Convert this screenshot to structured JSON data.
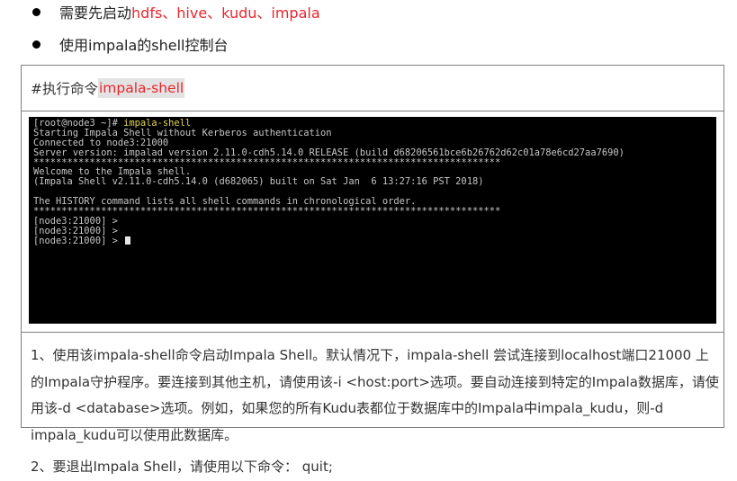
{
  "bullets": [
    {
      "prefix": "需要先启动",
      "suffix": "hdfs、hive、kudu、impala"
    },
    {
      "text": "使用impala的shell控制台"
    }
  ],
  "command_row": {
    "prefix": "#执行命令",
    "command": "impala-shell"
  },
  "terminal": {
    "prompt": "[root@node3 ~]# ",
    "command": "impala-shell",
    "lines": [
      "Starting Impala Shell without Kerberos authentication",
      "Connected to node3:21000",
      "Server version: impalad version 2.11.0-cdh5.14.0 RELEASE (build d68206561bce6b26762d62c01a78e6cd27aa7690)",
      "***********************************************************************************",
      "Welcome to the Impala shell.",
      "(Impala Shell v2.11.0-cdh5.14.0 (d682065) built on Sat Jan  6 13:27:16 PST 2018)",
      "",
      "The HISTORY command lists all shell commands in chronological order.",
      "***********************************************************************************",
      "[node3:21000] >",
      "[node3:21000] >"
    ],
    "final_prompt": "[node3:21000] > "
  },
  "description": {
    "paragraph1": "1、使用该impala-shell命令启动Impala Shell。默认情况下，impala-shell 尝试连接到localhost端口21000 上的Impala守护程序。要连接到其他主机，请使用该-i <host:port>选项。要自动连接到特定的Impala数据库，请使用该-d <database>选项。例如，如果您的所有Kudu表都位于数据库中的Impala中impala_kudu，则-d impala_kudu可以使用此数据库。",
    "paragraph2": "2、要退出Impala Shell，请使用以下命令：  quit;"
  },
  "colors": {
    "accent_red": "#e8262d",
    "terminal_bg": "#000000",
    "terminal_fg": "#c7c7c7",
    "terminal_cmd": "#e6d84e"
  }
}
